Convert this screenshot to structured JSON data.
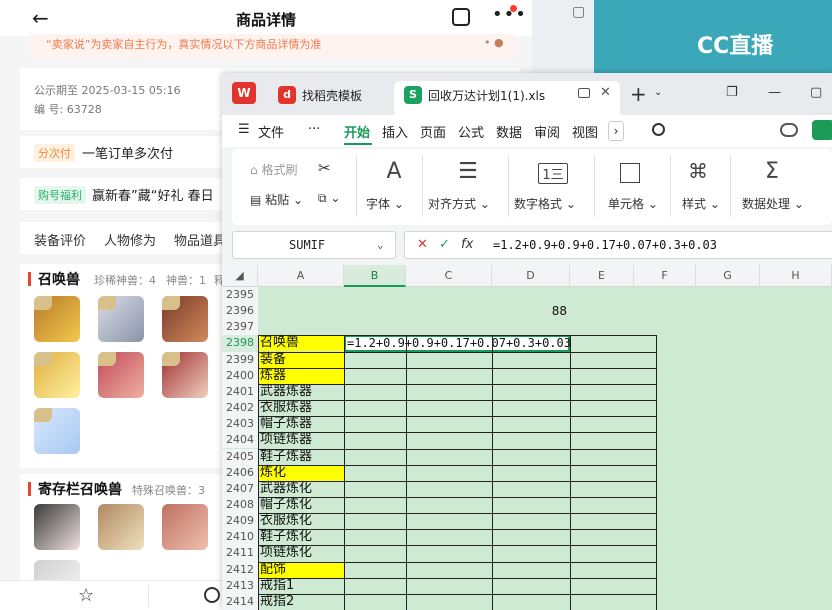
{
  "phone": {
    "header_title": "商品详情",
    "back_icon": "arrow-left-icon",
    "notice_text": "“卖家说”为卖家自主行为，真实情况以下方商品详情为准",
    "publicity_label": "公示期至 2025-03-15 05:16",
    "serial_label": "编 号: 63728",
    "tag_multi": "分次付",
    "tag_multi_text": "一笔订单多次付",
    "tag_benefit": "购号福利",
    "tag_benefit_text": "赢新春”藏“好礼 春日",
    "tabs": [
      "装备评价",
      "人物修为",
      "物品道具"
    ],
    "section1": {
      "title": "召唤兽",
      "meta1": "珍稀神兽：4",
      "meta2": "神兽：1",
      "meta3": "释"
    },
    "section2": {
      "title": "寄存栏召唤兽",
      "meta1": "特殊召唤兽：3"
    }
  },
  "right_panel": {
    "logo_text": "CC直播"
  },
  "wps": {
    "tabs": [
      {
        "label": "找稻壳模板",
        "icon": "docer-icon"
      },
      {
        "label": "回收万达计划1(1).xls",
        "icon": "spreadsheet-icon"
      }
    ],
    "app_logo": "W",
    "menu": [
      "文件",
      "开始",
      "插入",
      "页面",
      "公式",
      "数据",
      "审阅",
      "视图"
    ],
    "active_menu": "开始",
    "ribbon": {
      "format_painter": "格式刷",
      "paste": "粘贴",
      "font": "字体",
      "align": "对齐方式",
      "number_format": "数字格式",
      "cell": "单元格",
      "style": "样式",
      "data_process": "数据处理",
      "number_icon_text": "1三"
    },
    "name_box": "SUMIF",
    "formula": "=1.2+0.9+0.9+0.17+0.07+0.3+0.03",
    "columns": [
      "A",
      "B",
      "C",
      "D",
      "E",
      "F",
      "G",
      "H"
    ],
    "selected_column": "B",
    "rows": [
      {
        "num": "2395",
        "a": "",
        "yellow": false
      },
      {
        "num": "2396",
        "a": "",
        "yellow": false,
        "d": "88"
      },
      {
        "num": "2397",
        "a": "",
        "yellow": false
      },
      {
        "num": "2398",
        "a": "召唤兽",
        "yellow": true,
        "b": "=1.2+0.9+0.9+0.17+0.07+0.3+0.03"
      },
      {
        "num": "2399",
        "a": "装备",
        "yellow": true
      },
      {
        "num": "2400",
        "a": "炼器",
        "yellow": true
      },
      {
        "num": "2401",
        "a": "武器炼器",
        "yellow": false
      },
      {
        "num": "2402",
        "a": "衣服炼器",
        "yellow": false
      },
      {
        "num": "2403",
        "a": "帽子炼器",
        "yellow": false
      },
      {
        "num": "2404",
        "a": "项链炼器",
        "yellow": false
      },
      {
        "num": "2405",
        "a": "鞋子炼器",
        "yellow": false
      },
      {
        "num": "2406",
        "a": "炼化",
        "yellow": true
      },
      {
        "num": "2407",
        "a": "武器炼化",
        "yellow": false
      },
      {
        "num": "2408",
        "a": "帽子炼化",
        "yellow": false
      },
      {
        "num": "2409",
        "a": "衣服炼化",
        "yellow": false
      },
      {
        "num": "2410",
        "a": "鞋子炼化",
        "yellow": false
      },
      {
        "num": "2411",
        "a": "项链炼化",
        "yellow": false
      },
      {
        "num": "2412",
        "a": "配饰",
        "yellow": true
      },
      {
        "num": "2413",
        "a": "戒指1",
        "yellow": false
      },
      {
        "num": "2414",
        "a": "戒指2",
        "yellow": false
      }
    ],
    "colors": {
      "accent": "#1a9b58",
      "grid_bg": "#cfead2",
      "highlight": "#ffff00"
    }
  }
}
